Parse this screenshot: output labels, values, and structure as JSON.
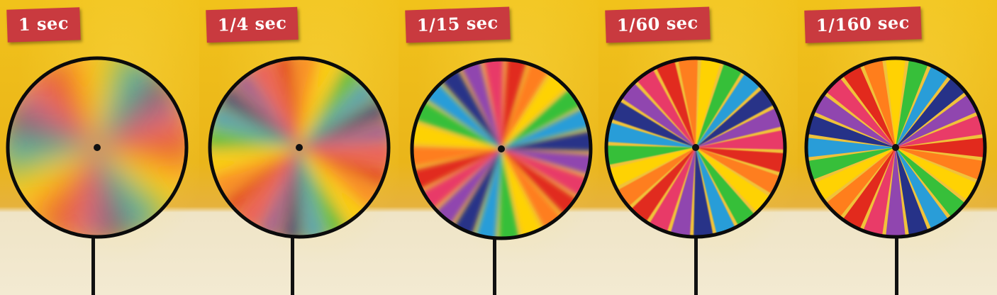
{
  "panels": [
    {
      "label": "1 sec",
      "blur": 18,
      "spin": 0
    },
    {
      "label": "1/4 sec",
      "blur": 10,
      "spin": 20
    },
    {
      "label": "1/15 sec",
      "blur": 3.5,
      "spin": 40
    },
    {
      "label": "1/60 sec",
      "blur": 0.8,
      "spin": 10
    },
    {
      "label": "1/160 sec",
      "blur": 0,
      "spin": 0
    }
  ],
  "pinwheel_colors": [
    "#e0221b",
    "#ff7a1a",
    "#ffd300",
    "#2cbf3a",
    "#1e9be0",
    "#1a2a8c",
    "#8a3fb5",
    "#e8346a"
  ]
}
